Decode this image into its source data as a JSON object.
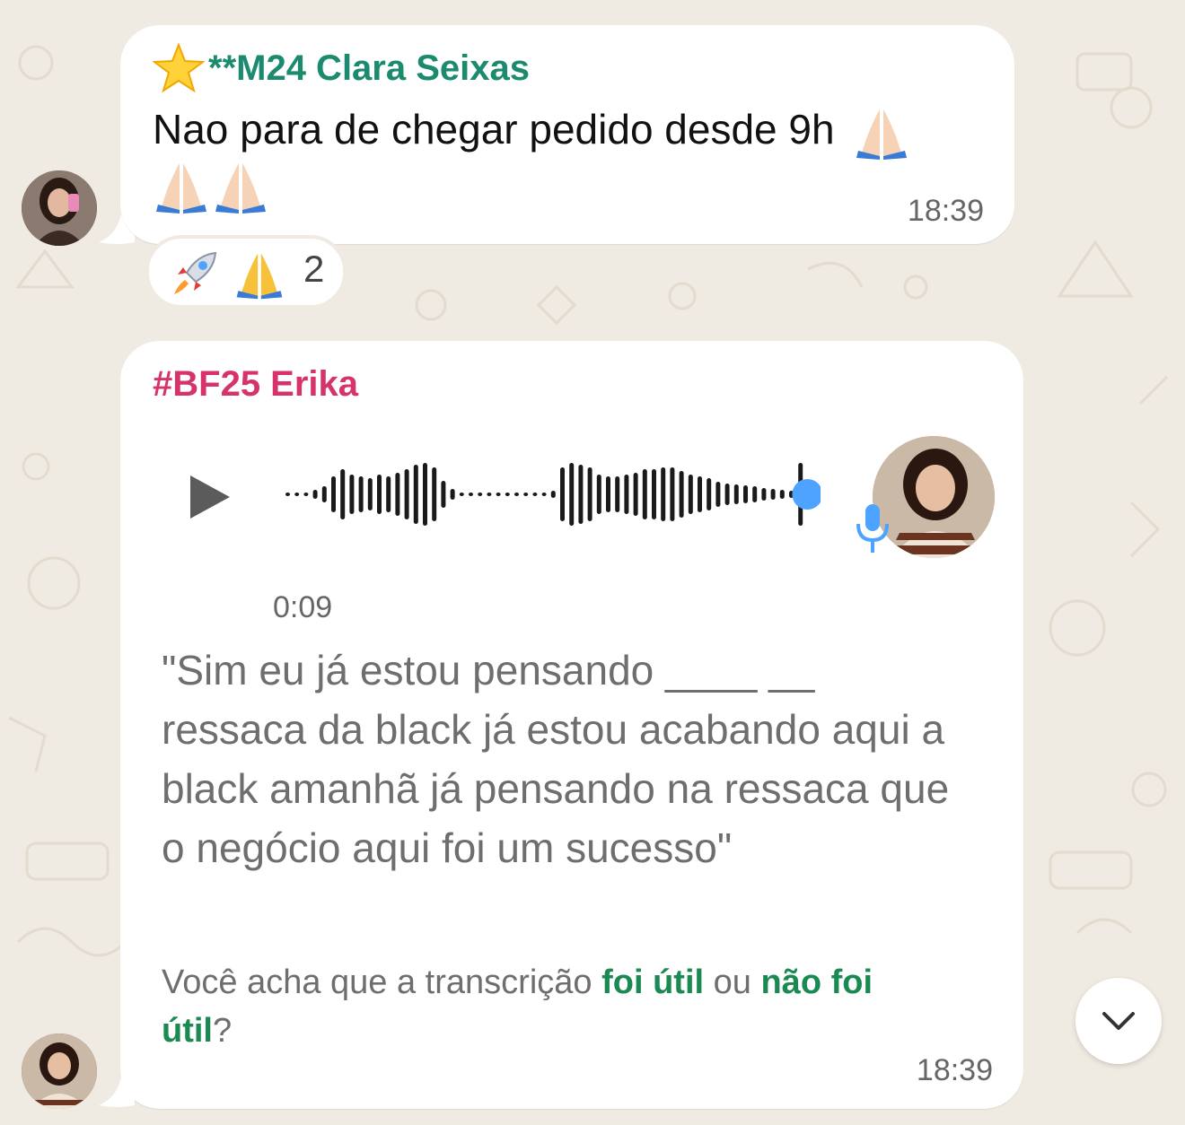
{
  "messages": [
    {
      "sender": "**M24 Clara Seixas",
      "sender_icon": "star-icon",
      "sender_color": "#1b8a6e",
      "text": "Nao para de chegar pedido desde 9h",
      "emoji_icon": "folded-hands-icon",
      "time": "18:39",
      "reactions": {
        "icons": [
          "rocket-icon",
          "folded-hands-icon"
        ],
        "count": "2"
      }
    },
    {
      "sender": "#BF25 Erika",
      "sender_color": "#d6336c",
      "voice": {
        "duration": "0:09",
        "progress": 1.0,
        "play_icon": "play-icon",
        "mic_icon": "microphone-icon"
      },
      "transcript": "\"Sim eu já estou pensando ____ __ ressaca da black já estou acabando aqui a black amanhã já pensando na ressaca que o negócio aqui foi um sucesso\"",
      "feedback": {
        "prefix": "Você acha que a transcrição",
        "useful": "foi útil",
        "middle": "ou",
        "not_useful_1": "não foi",
        "not_useful_2": "útil",
        "suffix": "?"
      },
      "time": "18:39"
    }
  ],
  "scroll_button_icon": "chevron-down-icon",
  "colors": {
    "background": "#efeae2",
    "bubble": "#ffffff",
    "link": "#1b8a52",
    "voice_dot": "#4da3ff"
  }
}
